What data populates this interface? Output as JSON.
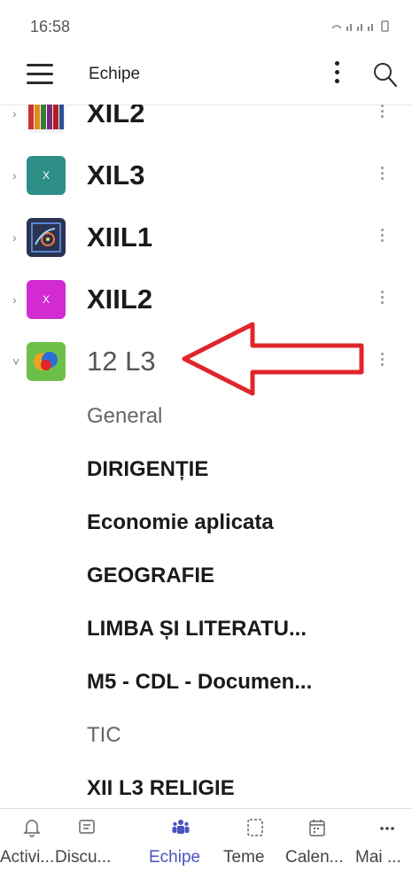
{
  "status_bar": {
    "time": "16:58"
  },
  "app_bar": {
    "title": "Echipe"
  },
  "teams": [
    {
      "name": "XIL2",
      "avatar_color": "#8b2b2b",
      "avatar_letter": "",
      "expanded": false
    },
    {
      "name": "XIL3",
      "avatar_color": "#2d8f85",
      "avatar_letter": "X",
      "expanded": false
    },
    {
      "name": "XIIL1",
      "avatar_color": "#2a3350",
      "avatar_letter": "",
      "expanded": false
    },
    {
      "name": "XIIL2",
      "avatar_color": "#d12bd1",
      "avatar_letter": "X",
      "expanded": false
    },
    {
      "name": "12 L3",
      "avatar_color": "#6cc04a",
      "avatar_letter": "",
      "expanded": true
    }
  ],
  "channels": [
    {
      "name": "General",
      "bold": false
    },
    {
      "name": "DIRIGENȚIE",
      "bold": true
    },
    {
      "name": "Economie aplicata",
      "bold": true
    },
    {
      "name": "GEOGRAFIE",
      "bold": true
    },
    {
      "name": "LIMBA ȘI LITERATU...",
      "bold": true
    },
    {
      "name": "M5 - CDL - Documen...",
      "bold": true
    },
    {
      "name": "TIC",
      "bold": false
    },
    {
      "name": "XII L3 RELIGIE",
      "bold": true
    }
  ],
  "bottom_nav": [
    {
      "label": "Activi...",
      "icon": "bell-icon",
      "active": false
    },
    {
      "label": "Discu...",
      "icon": "chat-icon",
      "active": false
    },
    {
      "label": "Echipe",
      "icon": "teams-icon",
      "active": true
    },
    {
      "label": "Teme",
      "icon": "assignments-icon",
      "active": false
    },
    {
      "label": "Calen...",
      "icon": "calendar-icon",
      "active": false
    },
    {
      "label": "Mai ...",
      "icon": "more-icon",
      "active": false
    }
  ],
  "colors": {
    "accent": "#4b53bc",
    "annotation": "#e0262b"
  }
}
